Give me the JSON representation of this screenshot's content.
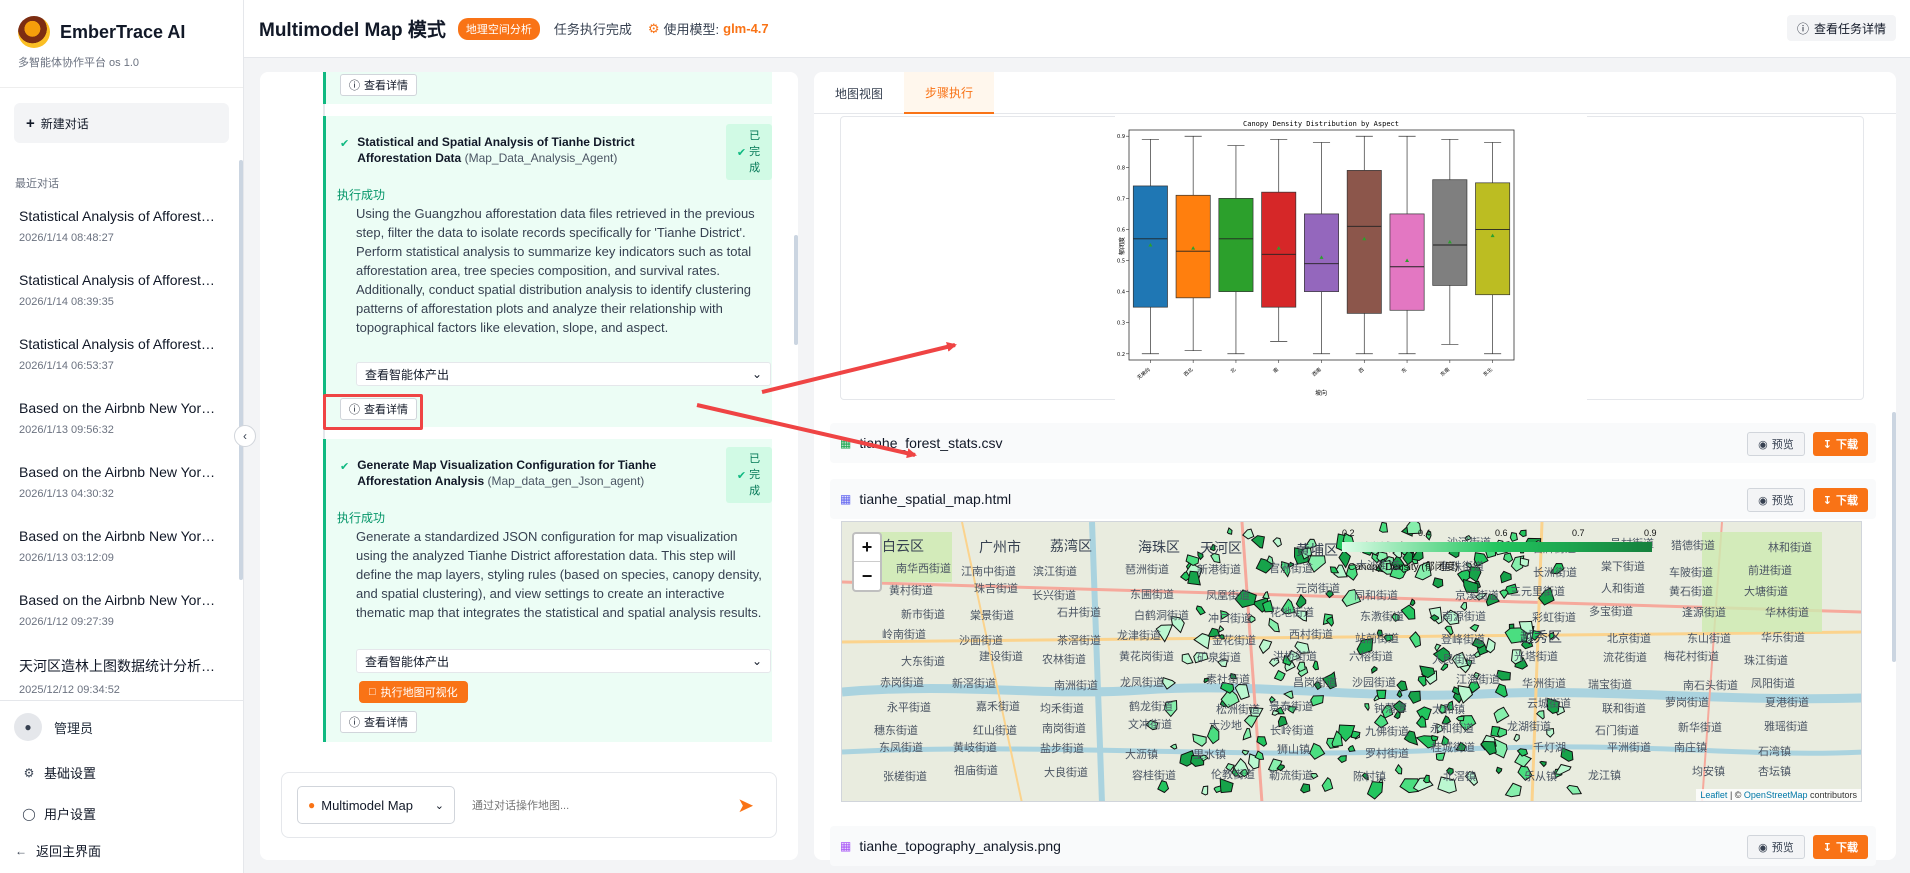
{
  "sidebar": {
    "brand_title": "EmberTrace AI",
    "brand_sub": "多智能体协作平台 os 1.0",
    "new_chat": "新建对话",
    "recent_label": "最近对话",
    "chats": [
      {
        "title": "Statistical Analysis of Afforestation",
        "time": "2026/1/14 08:48:27"
      },
      {
        "title": "Statistical Analysis of Afforestation",
        "time": "2026/1/14 08:39:35"
      },
      {
        "title": "Statistical Analysis of Afforestation",
        "time": "2026/1/14 06:53:37"
      },
      {
        "title": "Based on the Airbnb New York data",
        "time": "2026/1/13 09:56:32"
      },
      {
        "title": "Based on the Airbnb New York data",
        "time": "2026/1/13 04:30:32"
      },
      {
        "title": "Based on the Airbnb New York data",
        "time": "2026/1/13 03:12:09"
      },
      {
        "title": "Based on the Airbnb New York data",
        "time": "2026/1/12 09:27:39"
      },
      {
        "title": "天河区造林上图数据统计分析及可视化",
        "time": "2025/12/12 09:34:52"
      }
    ],
    "user_name": "管理员",
    "basic_settings": "基础设置",
    "user_settings": "用户设置",
    "back_main": "返回主界面"
  },
  "header": {
    "title": "Multimodel Map 模式",
    "tag": "地理空间分析",
    "status": "任务执行完成",
    "model_label": "使用模型:",
    "model_name": "glm-4.7",
    "task_detail": "查看任务详情"
  },
  "steps": {
    "view_detail": "查看详情",
    "done_chars": [
      "已",
      "完",
      "成"
    ],
    "exec_ok": "执行成功",
    "view_output": "查看智能体产出",
    "step1": {
      "title": "Statistical and Spatial Analysis of Tianhe District Afforestation Data",
      "agent": "(Map_Data_Analysis_Agent)",
      "desc": "Using the Guangzhou afforestation data files retrieved in the previous step, filter the data to isolate records specifically for 'Tianhe District'. Perform statistical analysis to summarize key indicators such as total afforestation area, tree species composition, and survival rates. Additionally, conduct spatial distribution analysis to identify clustering patterns of afforestation plots and analyze their relationship with topographical factors like elevation, slope, and aspect."
    },
    "step2": {
      "title": "Generate Map Visualization Configuration for Tianhe Afforestation Analysis",
      "agent": "(Map_data_gen_Json_agent)",
      "desc": "Generate a standardized JSON configuration for map visualization using the analyzed Tianhe District afforestation data. This step will define the map layers, styling rules (based on species, canopy density, and spatial clustering), and view settings to create an interactive thematic map that integrates the statistical and spatial analysis results.",
      "map_btn": "执行地图可视化"
    }
  },
  "input": {
    "mode": "Multimodel Map",
    "placeholder": "通过对话操作地图..."
  },
  "right": {
    "tabs": [
      "地图视图",
      "步骤执行"
    ],
    "preview": "预览",
    "download": "下载",
    "files": [
      "tianhe_forest_stats.csv",
      "tianhe_spatial_map.html",
      "tianhe_topography_analysis.png"
    ]
  },
  "chart_data": {
    "type": "box",
    "title": "Canopy Density Distribution by Aspect",
    "xlabel": "坡向",
    "ylabel": "郁闭度",
    "categories": [
      "无坡向",
      "西北",
      "北",
      "南",
      "西南",
      "西",
      "东",
      "东南",
      "东北"
    ],
    "colors": [
      "#1f77b4",
      "#ff7f0e",
      "#2ca02c",
      "#d62728",
      "#9467bd",
      "#8c564b",
      "#e377c2",
      "#7f7f7f",
      "#bcbd22"
    ],
    "ylim": [
      0.18,
      0.92
    ],
    "yticks": [
      0.2,
      0.3,
      0.4,
      0.5,
      0.6,
      0.7,
      0.8,
      0.9
    ],
    "boxes": [
      {
        "min": 0.2,
        "q1": 0.35,
        "median": 0.57,
        "q3": 0.74,
        "max": 0.89,
        "mean": 0.55
      },
      {
        "min": 0.21,
        "q1": 0.38,
        "median": 0.53,
        "q3": 0.71,
        "max": 0.9,
        "mean": 0.54
      },
      {
        "min": 0.2,
        "q1": 0.4,
        "median": 0.57,
        "q3": 0.7,
        "max": 0.87,
        "mean": 0.55
      },
      {
        "min": 0.24,
        "q1": 0.35,
        "median": 0.52,
        "q3": 0.72,
        "max": 0.89,
        "mean": 0.54
      },
      {
        "min": 0.2,
        "q1": 0.4,
        "median": 0.49,
        "q3": 0.65,
        "max": 0.88,
        "mean": 0.51
      },
      {
        "min": 0.2,
        "q1": 0.33,
        "median": 0.61,
        "q3": 0.79,
        "max": 0.9,
        "mean": 0.57
      },
      {
        "min": 0.2,
        "q1": 0.34,
        "median": 0.48,
        "q3": 0.65,
        "max": 0.9,
        "mean": 0.5
      },
      {
        "min": 0.23,
        "q1": 0.42,
        "median": 0.55,
        "q3": 0.76,
        "max": 0.89,
        "mean": 0.56
      },
      {
        "min": 0.2,
        "q1": 0.39,
        "median": 0.6,
        "q3": 0.75,
        "max": 0.88,
        "mean": 0.58
      }
    ]
  },
  "map": {
    "legend_ticks": [
      "0.2",
      "0.4",
      "0.6",
      "0.7",
      "0.9"
    ],
    "legend_title": "Canopy Density (郁闭度)",
    "attrib_leaflet": "Leaflet",
    "attrib_sep": " | © ",
    "attrib_osm": "OpenStreetMap",
    "attrib_tail": " contributors",
    "labels": [
      "白云区",
      "广州市",
      "荔湾区",
      "海珠区",
      "天河区",
      "黄埔区",
      "科学城",
      "沙河街道",
      "石牌街道",
      "员村街道",
      "猎德街道",
      "林和街道",
      "南华西街道",
      "江南中街道",
      "滨江街道",
      "琶洲街道",
      "新港街道",
      "官洲街道",
      "大沙街道",
      "鱼珠街道",
      "长洲街道",
      "棠下街道",
      "车陂街道",
      "前进街道",
      "黄村街道",
      "珠吉街道",
      "长兴街道",
      "东圃街道",
      "凤凰街道",
      "元岗街道",
      "同和街道",
      "京溪街道",
      "三元里街道",
      "人和街道",
      "黄石街道",
      "大塘街道",
      "新市街道",
      "棠景街道",
      "石井街道",
      "白鹤洞街道",
      "冲口街道",
      "花地街道",
      "东漖街道",
      "南源街道",
      "彩虹街道",
      "多宝街道",
      "逢源街道",
      "华林街道",
      "岭南街道",
      "沙面街道",
      "茶滘街道",
      "龙津街道",
      "金花街道",
      "西村街道",
      "站前街道",
      "登峰街道",
      "越秀区",
      "北京街道",
      "东山街道",
      "华乐街道",
      "大东街道",
      "建设街道",
      "农林街道",
      "黄花岗街道",
      "矿泉街道",
      "洪桥街道",
      "六榕街道",
      "人民街道",
      "光塔街道",
      "流花街道",
      "梅花村街道",
      "珠江街道",
      "赤岗街道",
      "新滘街道",
      "南洲街道",
      "龙凤街道",
      "素社街道",
      "昌岗街道",
      "沙园街道",
      "江海街道",
      "华洲街道",
      "瑞宝街道",
      "南石头街道",
      "凤阳街道",
      "永平街道",
      "嘉禾街道",
      "均禾街道",
      "鹤龙街道",
      "松洲街道",
      "景泰街道",
      "钟落潭",
      "太和镇",
      "云城街道",
      "联和街道",
      "萝岗街道",
      "夏港街道",
      "穗东街道",
      "红山街道",
      "南岗街道",
      "文冲街道",
      "大沙地",
      "长岭街道",
      "九佛街道",
      "永和街道",
      "龙湖街道",
      "石门街道",
      "新华街道",
      "雅瑶街道",
      "东凤街道",
      "黄岐街道",
      "盐步街道",
      "大沥镇",
      "里水镇",
      "狮山镇",
      "罗村街道",
      "桂城街道",
      "千灯湖",
      "平洲街道",
      "南庄镇",
      "石湾镇",
      "张槎街道",
      "祖庙街道",
      "大良街道",
      "容桂街道",
      "伦教街道",
      "勒流街道",
      "陈村镇",
      "北滘镇",
      "乐从镇",
      "龙江镇",
      "均安镇",
      "杏坛镇"
    ]
  }
}
